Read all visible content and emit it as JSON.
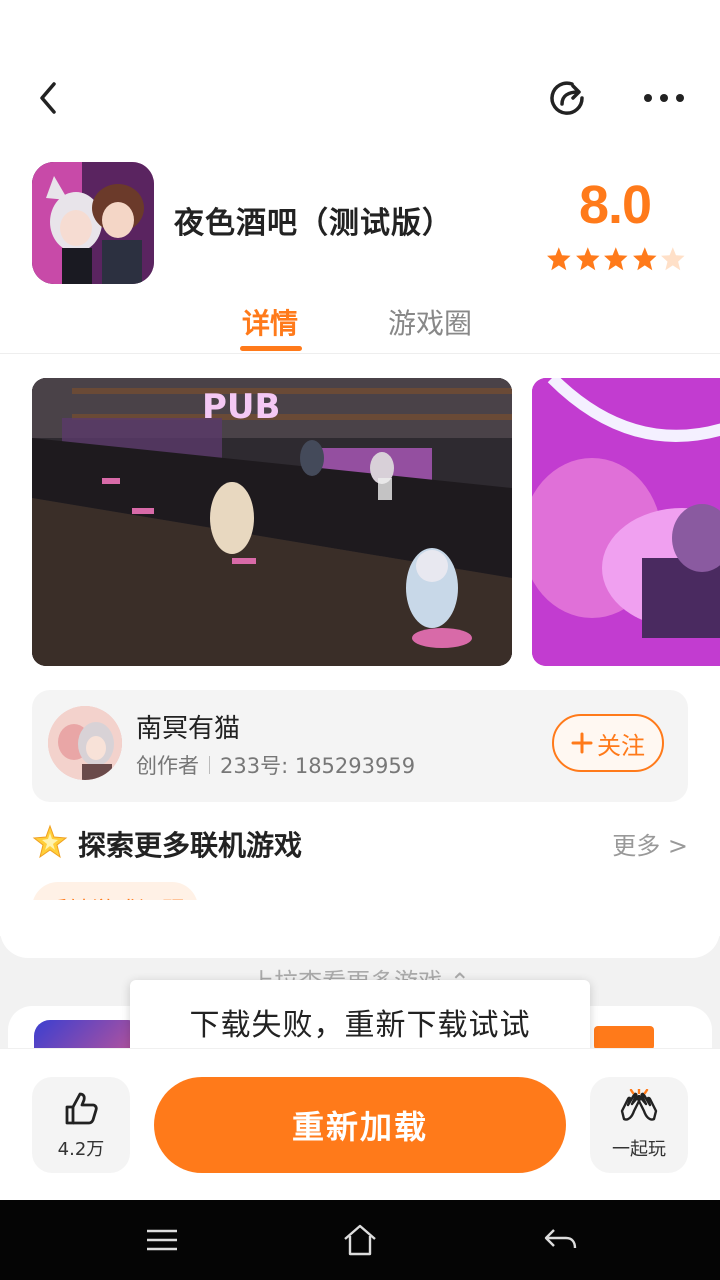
{
  "app": {
    "title": "夜色酒吧（测试版）",
    "score": "8.0",
    "rating_stars": 4.5,
    "accent_color": "#ff7a1a"
  },
  "header": {
    "back_icon": "chevron-left-icon",
    "share_icon": "share-icon",
    "more_icon": "more-dots-icon"
  },
  "tabs": [
    {
      "label": "详情",
      "active": true
    },
    {
      "label": "游戏圈",
      "active": false
    }
  ],
  "creator": {
    "name": "南冥有猫",
    "role": "创作者",
    "id_text": "233号: 185293959",
    "follow_label": "关注"
  },
  "explore": {
    "title": "探索更多联机游戏",
    "more_label": "更多 >"
  },
  "feedback_label": "反馈游戏问题",
  "pull_hint": "上拉查看更多游戏 ⌃",
  "toast": "下载失败，重新下载试试",
  "bottom": {
    "like_count": "4.2万",
    "reload_label": "重新加载",
    "play_together_label": "一起玩"
  }
}
